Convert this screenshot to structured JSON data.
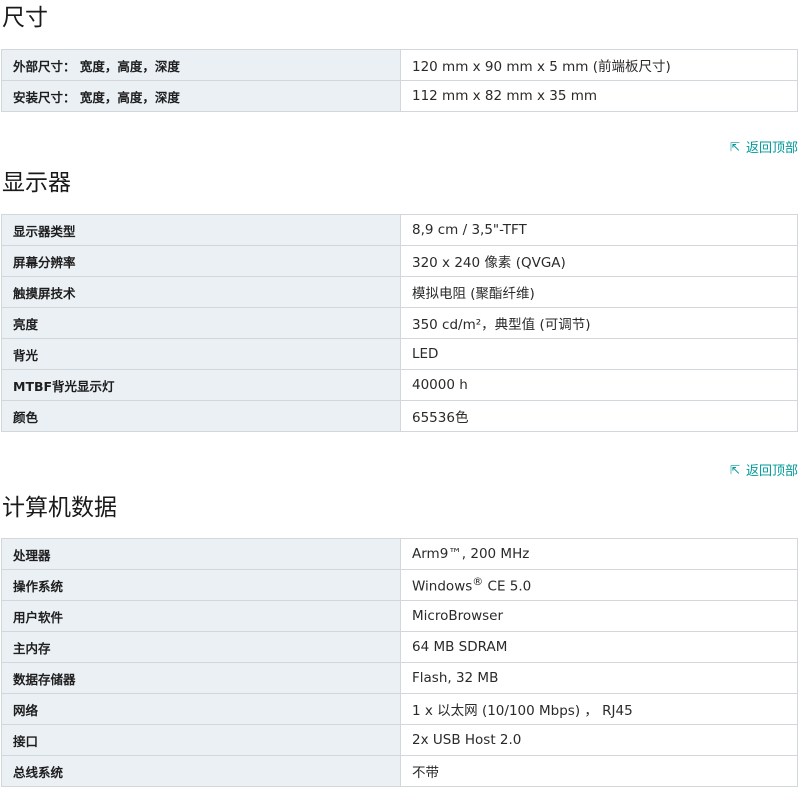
{
  "back_to_top": "返回顶部",
  "sections": [
    {
      "title": "尺寸",
      "rows": [
        {
          "key": "外部尺寸：  宽度，高度，深度",
          "value": "120 mm x 90 mm x 5 mm (前端板尺寸)"
        },
        {
          "key": "安装尺寸：  宽度，高度，深度",
          "value": "112 mm x 82 mm x 35 mm"
        }
      ]
    },
    {
      "title": "显示器",
      "rows": [
        {
          "key": "显示器类型",
          "value": "8,9 cm / 3,5\"-TFT"
        },
        {
          "key": "屏幕分辨率",
          "value": "320 x 240 像素 (QVGA)"
        },
        {
          "key": "触摸屏技术",
          "value": "模拟电阻 (聚酯纤维)"
        },
        {
          "key": "亮度",
          "value": "350 cd/m²，典型值 (可调节)"
        },
        {
          "key": "背光",
          "value": "LED"
        },
        {
          "key": "MTBF背光显示灯",
          "value": "40000 h"
        },
        {
          "key": "颜色",
          "value": "65536色"
        }
      ]
    },
    {
      "title": "计算机数据",
      "rows": [
        {
          "key": "处理器",
          "value": "Arm9™, 200 MHz"
        },
        {
          "key": "操作系统",
          "value_main": "Windows",
          "value_sup": "®",
          "value_rest": " CE 5.0"
        },
        {
          "key": "用户软件",
          "value": "MicroBrowser"
        },
        {
          "key": "主内存",
          "value": "64 MB SDRAM"
        },
        {
          "key": "数据存储器",
          "value": "Flash, 32 MB"
        },
        {
          "key": "网络",
          "value": "1 x 以太网 (10/100 Mbps) ， RJ45"
        },
        {
          "key": "接口",
          "value": "2x USB Host 2.0"
        },
        {
          "key": "总线系统",
          "value": "不带"
        }
      ]
    }
  ]
}
